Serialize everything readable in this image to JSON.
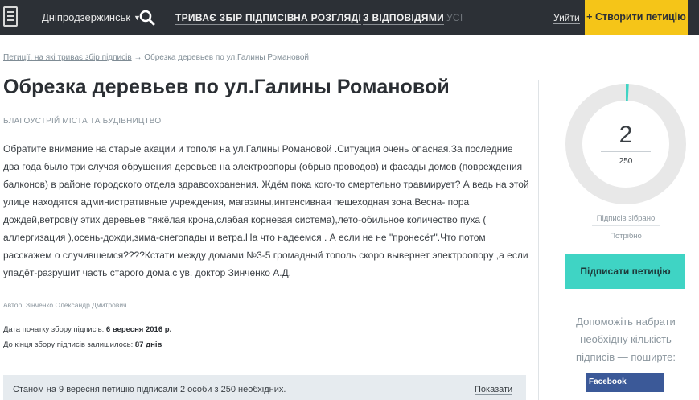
{
  "header": {
    "city": "Дніпродзержинськ",
    "nav": [
      {
        "label": "ТРИВАЄ ЗБІР ПІДПИСІВ"
      },
      {
        "label": "НА РОЗГЛЯДІ"
      },
      {
        "label": "З ВІДПОВІДЯМИ"
      },
      {
        "label": "УСІ"
      }
    ],
    "logout": "Уийти",
    "create_button": "+ Створити петицію"
  },
  "breadcrumb": {
    "link": "Петиції, на які триває збір підписів",
    "current": "→ Обрезка деревьев по ул.Галины Романовой"
  },
  "petition": {
    "title": "Обрезка деревьев по ул.Галины Романовой",
    "category": "БЛАГОУСТРІЙ МІСТА ТА БУДІВНИЦТВО",
    "body": "Обратите внимание на старые акации и тополя на ул.Галины Романовой .Ситуация очень опасная.За последние два года было три случая обрушения деревьев на электроопоры (обрыв проводов) и фасады домов (повреждения балконов) в районе городского отдела здравоохранения. Ждём пока кого-то смертельно травмирует? А ведь на этой улице находятся административные учреждения, магазины,интенсивная пешеходная зона.Весна- пора дождей,ветров(у этих деревьев тяжёлая крона,слабая корневая система),лето-обильное количество пуха ( аллергизация ),осень-дожди,зима-снегопады и ветра.На что надеемся . А если не не \"пронесёт\".Что потом расскажем о случившемся????Кстати между домами №3-5 громадный тополь скоро вывернет электроопору ,а если упадёт-разрушит часть старого дома.с ув. доктор Зинченко А.Д.",
    "author": "Автор: Зінченко Олександр Дмитрович",
    "start_label": "Дата початку збору підписів:",
    "start_value": "6 вересня 2016 р.",
    "remaining_label": "До кінця збору підписів залишилось:",
    "remaining_value": "87 днів",
    "status_text": "Станом на 9 вересня петицію підписали 2 особи з 250 необхідних.",
    "show_link": "Показати"
  },
  "sidebar": {
    "signatures_collected": 2,
    "signatures_needed": 250,
    "progress_fraction": 0.008,
    "collected_label": "Підписів зібрано",
    "needed_label": "Потрібно",
    "sign_button": "Підписати петицію",
    "share_text": "Допоможіть набрати необхідну кількість підписів — поширте:",
    "facebook_button": "Facebook"
  },
  "colors": {
    "topbar": "#2c3036",
    "accent_yellow": "#f5c518",
    "accent_teal": "#3fd4c4",
    "ring_track": "#e8e8e8",
    "facebook": "#3b5998"
  }
}
